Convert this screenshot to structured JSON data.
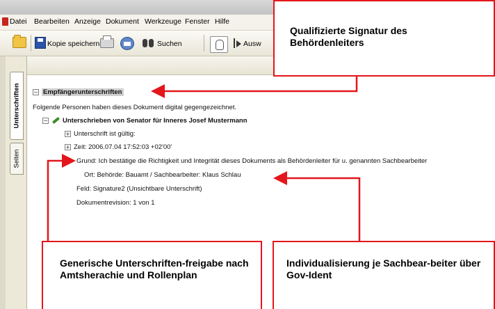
{
  "menubar": {
    "items": [
      "Datei",
      "Bearbeiten",
      "Anzeige",
      "Dokument",
      "Werkzeuge",
      "Fenster",
      "Hilfe"
    ]
  },
  "toolbar": {
    "save_label": "Kopie speichern",
    "search_label": "Suchen",
    "select_label": "Ausw"
  },
  "side_tabs": {
    "signatures": "Unterschriften",
    "pages": "Seiten"
  },
  "signature_panel": {
    "heading": "Empfängerunterschriften",
    "intro": "Folgende Personen haben dieses Dokument digital gegengezeichnet.",
    "signer": "Unterschrieben von Senator für Inneres Josef Mustermann",
    "validity": "Unterschrift ist gültig:",
    "time": "Zeit: 2006.07.04 17:52:03 +02'00'",
    "reason": "Grund: Ich bestätige die Richtigkeit und Integrität dieses Dokuments als Behördenleiter für u. genannten Sachbearbeiter",
    "location": "Ort: Behörde: Bauamt / Sachbearbeiter: Klaus Schlau",
    "field": "Feld: Signature2 (Unsichtbare Unterschrift)",
    "revision": "Dokumentrevision: 1 von 1"
  },
  "callouts": {
    "top": "Qualifizierte Signatur des Behördenleiters",
    "left": "Generische Unterschriften-freigabe nach Amtsherachie und Rollenplan",
    "right": "Individualisierung je Sachbear-beiter über Gov-Ident"
  },
  "colors": {
    "callout_border": "#e3161b",
    "arrow": "#e3161b",
    "window_background": "#ece9d8",
    "heading_highlight": "#cfcfcf"
  }
}
